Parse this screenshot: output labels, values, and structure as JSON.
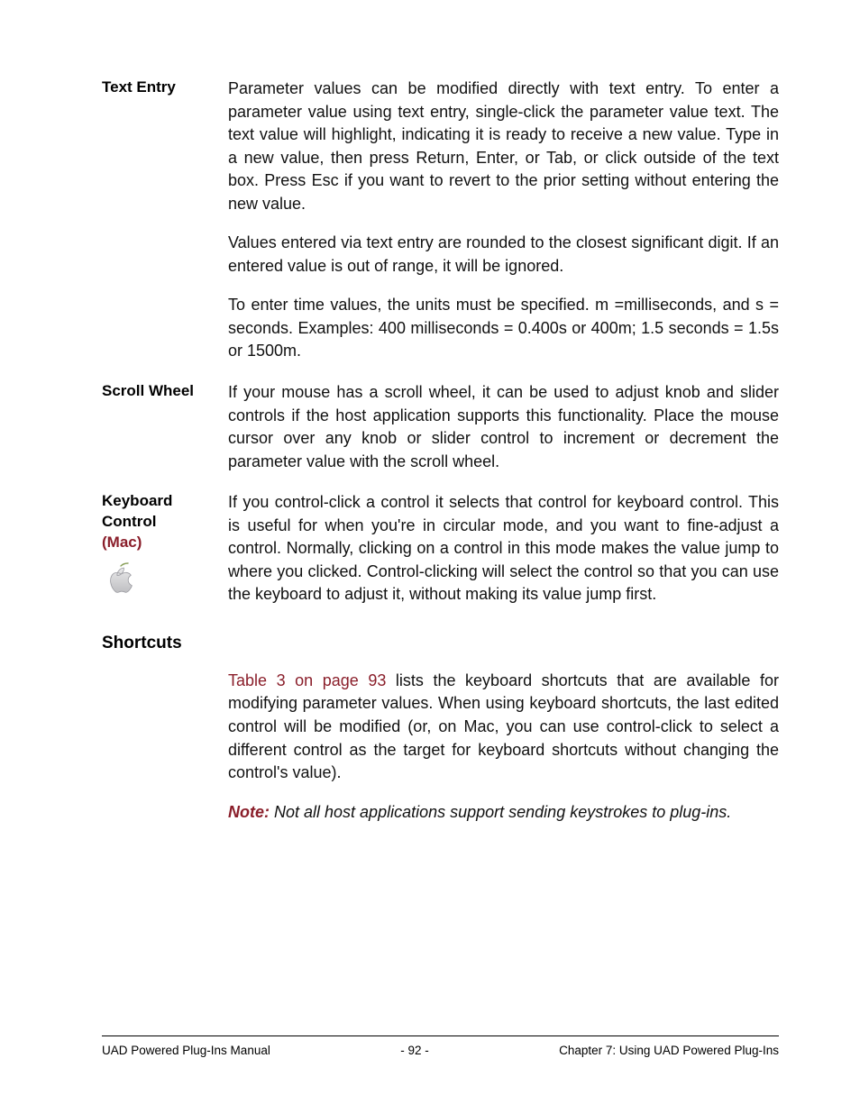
{
  "sections": {
    "textEntry": {
      "label": "Text Entry",
      "p1": "Parameter values can be modified directly with text entry. To enter a parameter value using text entry, single-click the parameter value text. The text value will highlight, indicating it is ready to receive a new value. Type in a new value, then press Return, Enter, or Tab, or click outside of the text box. Press Esc if you want to revert to the prior setting without entering the new value.",
      "p2": "Values entered via text entry are rounded to the closest significant digit. If an entered value is out of range, it will be ignored.",
      "p3": "To enter time values, the units must be specified. m =milliseconds, and s = seconds. Examples: 400 milliseconds = 0.400s or 400m; 1.5 seconds = 1.5s or 1500m."
    },
    "scrollWheel": {
      "label": "Scroll Wheel",
      "p1": "If your mouse has a scroll wheel, it can be used to adjust knob and slider controls if the host application supports this functionality. Place the mouse cursor over any knob or slider control to increment or decrement the parameter value with the scroll wheel."
    },
    "keyboardControl": {
      "labelLine1": "Keyboard",
      "labelLine2": "Control",
      "labelMac": "(Mac)",
      "p1": "If you control-click a control it selects that control for keyboard control. This is useful for when you're in circular mode, and you want to fine-adjust a control. Normally, clicking on a control in this mode makes the value jump to where you clicked. Control-clicking will select the control so that you can use the keyboard to adjust it, without making its value jump first."
    },
    "shortcuts": {
      "heading": "Shortcuts",
      "link": "Table 3 on page 93",
      "p1rest": " lists the keyboard shortcuts that are available for modifying parameter values. When using keyboard shortcuts, the last edited control will be modified (or, on Mac, you can use control-click to select a different control as the target for keyboard shortcuts without changing the control's value).",
      "noteLabel": "Note:",
      "noteBody": " Not all host applications support sending keystrokes to plug-ins."
    }
  },
  "footer": {
    "left": "UAD Powered Plug-Ins Manual",
    "center": "- 92 -",
    "right": "Chapter 7: Using UAD Powered Plug-Ins"
  }
}
